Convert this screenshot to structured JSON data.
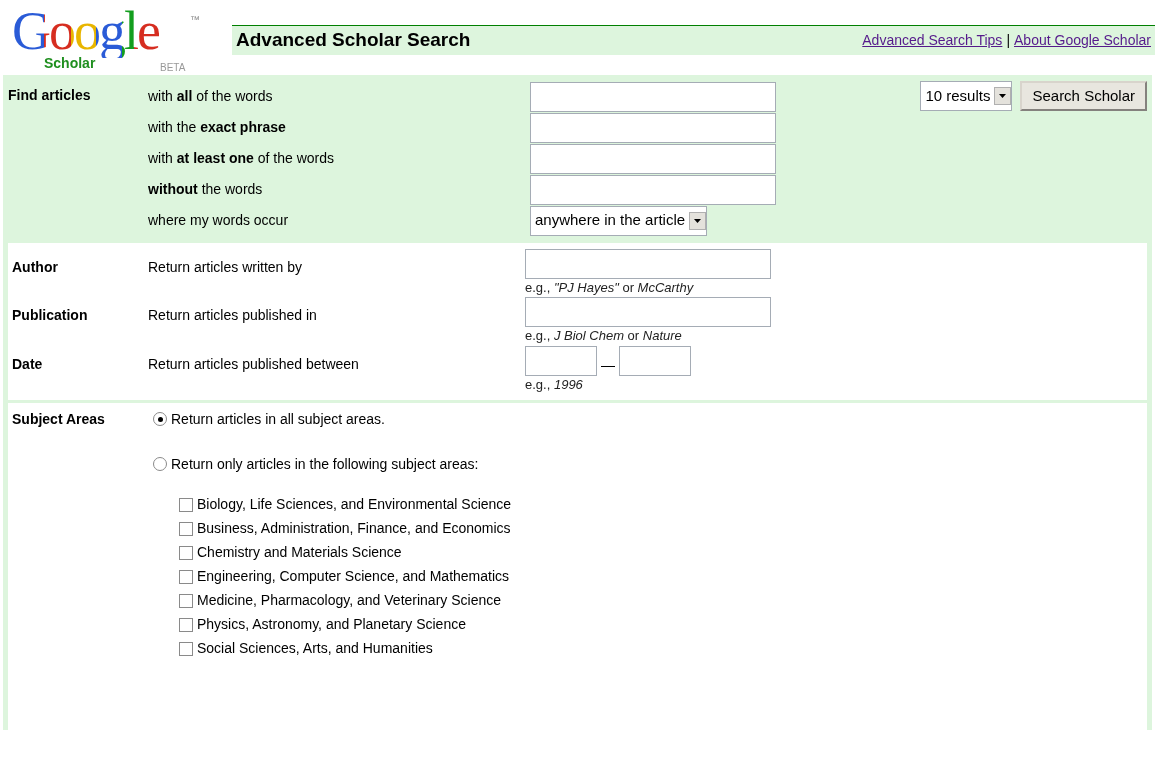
{
  "header": {
    "logo": {
      "word": "Google",
      "tm": "™",
      "sub": "Scholar",
      "beta": "BETA"
    },
    "title": "Advanced Scholar Search",
    "links": [
      "Advanced Search Tips",
      "About Google Scholar"
    ],
    "link_separator": "|"
  },
  "find": {
    "label": "Find articles",
    "rows": [
      {
        "kind": "text",
        "label": "with **all** of the words"
      },
      {
        "kind": "text",
        "label": "with the **exact phrase**"
      },
      {
        "kind": "text",
        "label": "with **at least one** of the words"
      },
      {
        "kind": "text",
        "label": "**without** the words"
      },
      {
        "kind": "select",
        "label": "where my words occur",
        "value": "anywhere in the article"
      }
    ],
    "results": "10 results",
    "button": "Search Scholar"
  },
  "fields": [
    {
      "kind": "text",
      "label": "Author",
      "description": "Return articles written by",
      "example": "e.g., *\"PJ Hayes\"* or *McCarthy*"
    },
    {
      "kind": "text",
      "label": "Publication",
      "description": "Return articles published in",
      "example": "e.g., *J Biol Chem* or *Nature*"
    },
    {
      "kind": "range",
      "label": "Date",
      "description": "Return articles published between",
      "separator": "—",
      "example": "e.g., *1996*"
    }
  ],
  "subjects": {
    "label": "Subject Areas",
    "options": [
      {
        "label": "Return articles in all subject areas.",
        "selected": true
      },
      {
        "label": "Return only articles in the following subject areas:",
        "selected": false
      }
    ],
    "areas": [
      {
        "label": "Biology, Life Sciences, and Environmental Science",
        "checked": false
      },
      {
        "label": "Business, Administration, Finance, and Economics",
        "checked": false
      },
      {
        "label": "Chemistry and Materials Science",
        "checked": false
      },
      {
        "label": "Engineering, Computer Science, and Mathematics",
        "checked": false
      },
      {
        "label": "Medicine, Pharmacology, and Veterinary Science",
        "checked": false
      },
      {
        "label": "Physics, Astronomy, and Planetary Science",
        "checked": false
      },
      {
        "label": "Social Sciences, Arts, and Humanities",
        "checked": false
      }
    ]
  }
}
